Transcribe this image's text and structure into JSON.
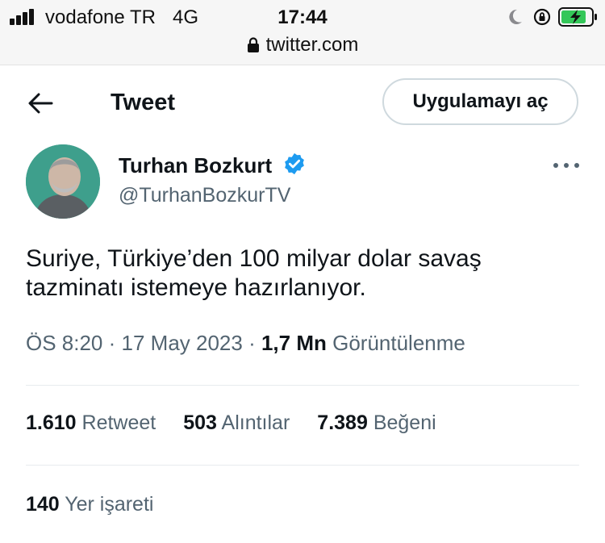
{
  "status_bar": {
    "carrier": "vodafone TR",
    "network": "4G",
    "time": "17:44",
    "url": "twitter.com"
  },
  "header": {
    "title": "Tweet",
    "open_app_label": "Uygulamayı aç"
  },
  "author": {
    "display_name": "Turhan Bozkurt",
    "handle": "@TurhanBozkurTV",
    "verified": true
  },
  "tweet": {
    "text_line1": "Suriye, Türkiye’den 100 milyar dolar savaş",
    "text_line2": "tazminatı istemeye hazırlanıyor.",
    "time": "ÖS 8:20",
    "date": "17 May 2023",
    "sep": " · ",
    "views_count": "1,7 Mn",
    "views_label": "Görüntülenme"
  },
  "stats": {
    "retweets_count": "1.610",
    "retweets_label": "Retweet",
    "quotes_count": "503",
    "quotes_label": "Alıntılar",
    "likes_count": "7.389",
    "likes_label": "Beğeni",
    "bookmarks_count": "140",
    "bookmarks_label": "Yer işareti"
  },
  "colors": {
    "text_primary": "#0f1419",
    "text_secondary": "#536471",
    "verified_blue": "#1d9bf0",
    "battery_green": "#34c759",
    "avatar_bg": "#3e9f8c"
  },
  "icons": {
    "back": "arrow-left-icon",
    "more": "more-horizontal-icon",
    "verified": "verified-badge-icon",
    "lock": "lock-icon"
  }
}
